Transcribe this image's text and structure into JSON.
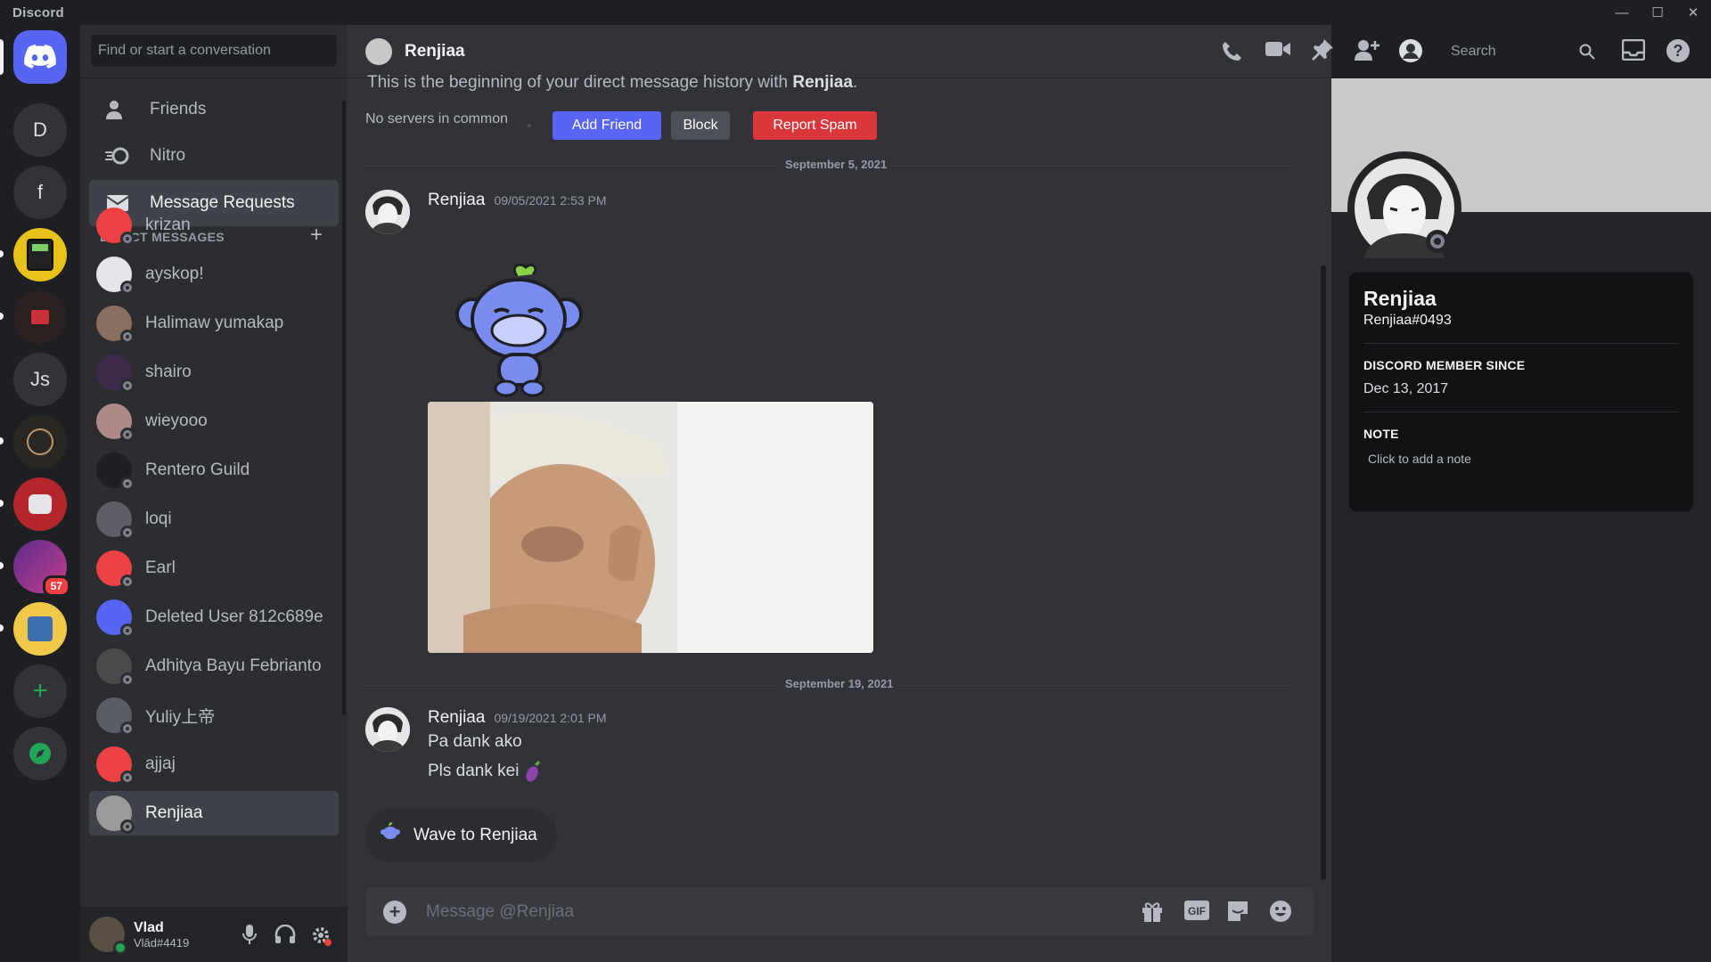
{
  "app": {
    "title": "Discord"
  },
  "colors": {
    "blurple": "#5865f2",
    "danger": "#da373c",
    "secondary_button": "#4e5058",
    "green": "#23a559",
    "background": "#313338"
  },
  "servers": [
    {
      "name": "Direct Messages",
      "icon": "discord-logo-icon"
    },
    {
      "name": "D",
      "initial": "D"
    },
    {
      "name": "f",
      "initial": "f"
    },
    {
      "name": "server-calculator",
      "icon": "calculator-icon"
    },
    {
      "name": "server-red",
      "icon": "server-image"
    },
    {
      "name": "Js",
      "initial": "Js"
    },
    {
      "name": "server-dark",
      "icon": "server-image"
    },
    {
      "name": "server-red-bot",
      "icon": "server-image"
    },
    {
      "name": "server-neon",
      "icon": "server-image",
      "badge": "57"
    },
    {
      "name": "server-yellow",
      "icon": "server-image"
    },
    {
      "name": "Add a Server",
      "icon": "plus-icon"
    },
    {
      "name": "Explore Servers",
      "icon": "compass-icon"
    }
  ],
  "dm_sidebar": {
    "search_placeholder": "Find or start a conversation",
    "nav": [
      {
        "label": "Friends",
        "icon": "friends-icon"
      },
      {
        "label": "Nitro",
        "icon": "nitro-icon"
      },
      {
        "label": "Message Requests",
        "icon": "envelope-icon"
      }
    ],
    "header": "DIRECT MESSAGES",
    "dms": [
      {
        "name": "krizan",
        "color": "#ed4245"
      },
      {
        "name": "ayskop!",
        "color": "#e3e5e8"
      },
      {
        "name": "Halimaw yumakap",
        "color": "#8a6f5e"
      },
      {
        "name": "shairo",
        "color": "#3b2a4a"
      },
      {
        "name": "wieyooo",
        "color": "#b08a8a"
      },
      {
        "name": "Rentero Guild",
        "color": "#1e1f22"
      },
      {
        "name": "loqi",
        "color": "#5e5e66"
      },
      {
        "name": "Earl",
        "color": "#ed4245"
      },
      {
        "name": "Deleted User 812c689e",
        "color": "#5865f2"
      },
      {
        "name": "Adhitya Bayu Febrianto",
        "color": "#4a4a4a"
      },
      {
        "name": "Yuliy上帝",
        "color": "#5a5d66"
      },
      {
        "name": "ajjaj",
        "color": "#ed4245"
      },
      {
        "name": "Renjiaa",
        "color": "#9a9a9a"
      }
    ]
  },
  "user_panel": {
    "name": "Vlad",
    "tag": "Vlād#4419"
  },
  "chat": {
    "title": "Renjiaa",
    "search_placeholder": "Search",
    "beginning_prefix": "This is the beginning of your direct message history with ",
    "beginning_name": "Renjiaa",
    "beginning_suffix": ".",
    "no_servers": "No servers in common",
    "add_friend": "Add Friend",
    "block": "Block",
    "report_spam": "Report Spam",
    "date1": "September 5, 2021",
    "date2": "September 19, 2021",
    "msg1": {
      "author": "Renjiaa",
      "time": "09/05/2021 2:53 PM"
    },
    "msg2": {
      "author": "Renjiaa",
      "time": "09/19/2021 2:01 PM",
      "line1": "Pa dank ako",
      "line2": "Pls dank kei"
    },
    "wave": "Wave to Renjiaa",
    "composer_placeholder": "Message @Renjiaa"
  },
  "profile": {
    "name": "Renjiaa",
    "tag": "Renjiaa#0493",
    "member_label": "DISCORD MEMBER SINCE",
    "member_since": "Dec 13, 2017",
    "note_label": "NOTE",
    "note_placeholder": "Click to add a note"
  }
}
